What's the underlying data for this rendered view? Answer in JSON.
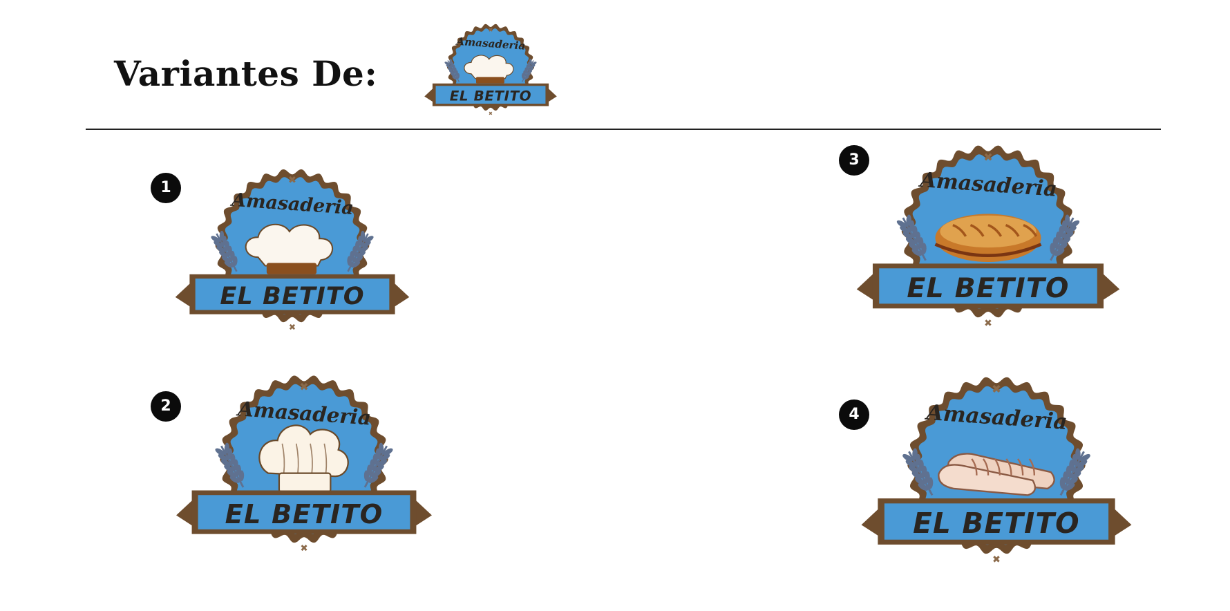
{
  "header": {
    "title": "Variantes De:"
  },
  "brand": {
    "script_text": "Amasaderia",
    "banner_text": "EL BETITO",
    "colors": {
      "badge_fill": "#4a9ad6",
      "frame": "#6e4d2e",
      "text": "#2a2520",
      "wheat": "#5f7190"
    }
  },
  "variants": [
    {
      "number": "1",
      "icon": "chef-hat-icon"
    },
    {
      "number": "2",
      "icon": "puffy-chef-hat-icon"
    },
    {
      "number": "3",
      "icon": "bread-loaf-icon"
    },
    {
      "number": "4",
      "icon": "baguettes-icon"
    }
  ]
}
